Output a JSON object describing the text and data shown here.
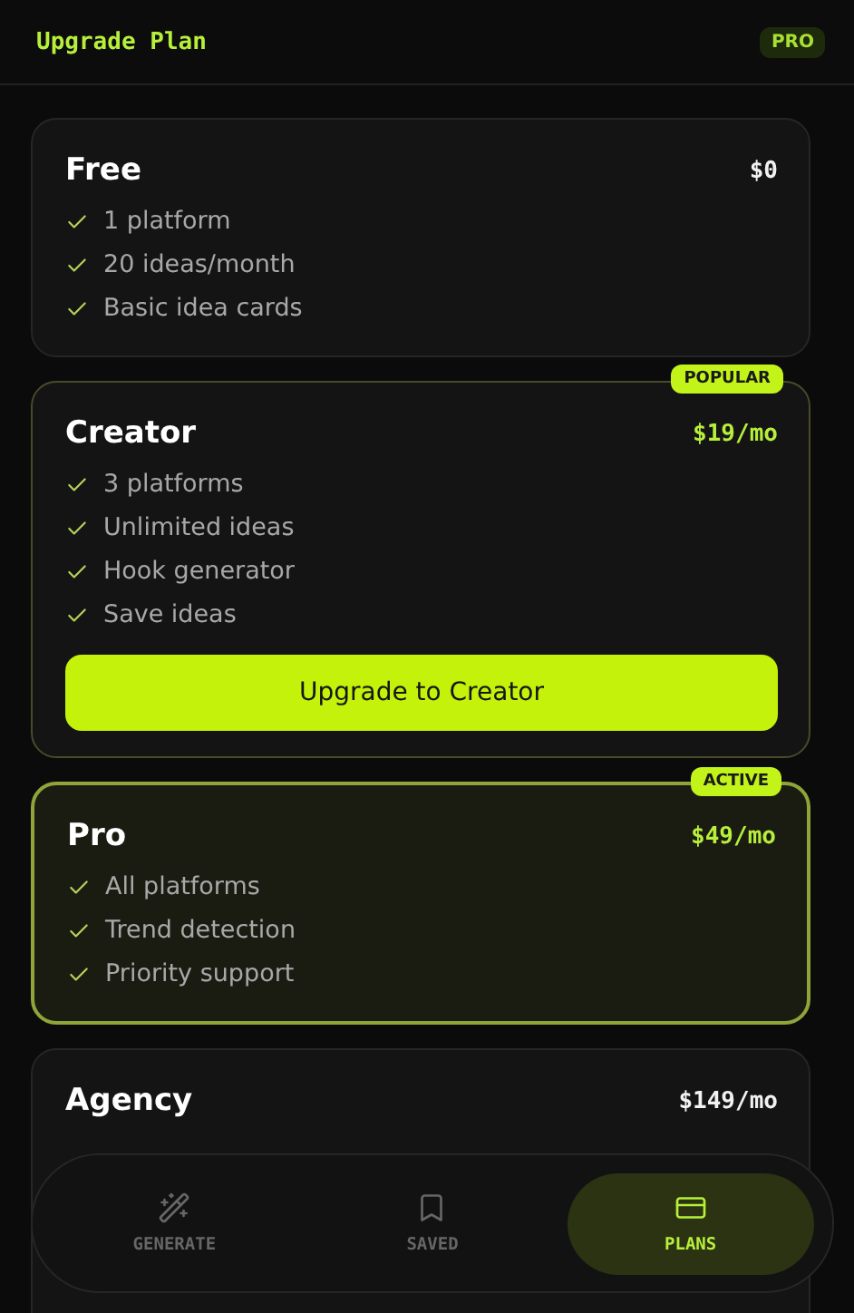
{
  "header": {
    "title": "Upgrade Plan",
    "badge": "PRO"
  },
  "plans": [
    {
      "name": "Free",
      "price": "$0",
      "featured": false,
      "active": false,
      "features": [
        "1 platform",
        "20 ideas/month",
        "Basic idea cards"
      ]
    },
    {
      "name": "Creator",
      "price": "$19/mo",
      "badge": "POPULAR",
      "featured": true,
      "active": false,
      "features": [
        "3 platforms",
        "Unlimited ideas",
        "Hook generator",
        "Save ideas"
      ],
      "button": "Upgrade to Creator"
    },
    {
      "name": "Pro",
      "price": "$49/mo",
      "badge": "ACTIVE",
      "featured": true,
      "active": true,
      "features": [
        "All platforms",
        "Trend detection",
        "Priority support"
      ]
    },
    {
      "name": "Agency",
      "price": "$149/mo",
      "featured": false,
      "active": false
    }
  ],
  "nav": [
    {
      "kind": "generate",
      "label": "GENERATE",
      "selected": false
    },
    {
      "kind": "saved",
      "label": "SAVED",
      "selected": false
    },
    {
      "kind": "plans",
      "label": "PLANS",
      "selected": true
    }
  ]
}
